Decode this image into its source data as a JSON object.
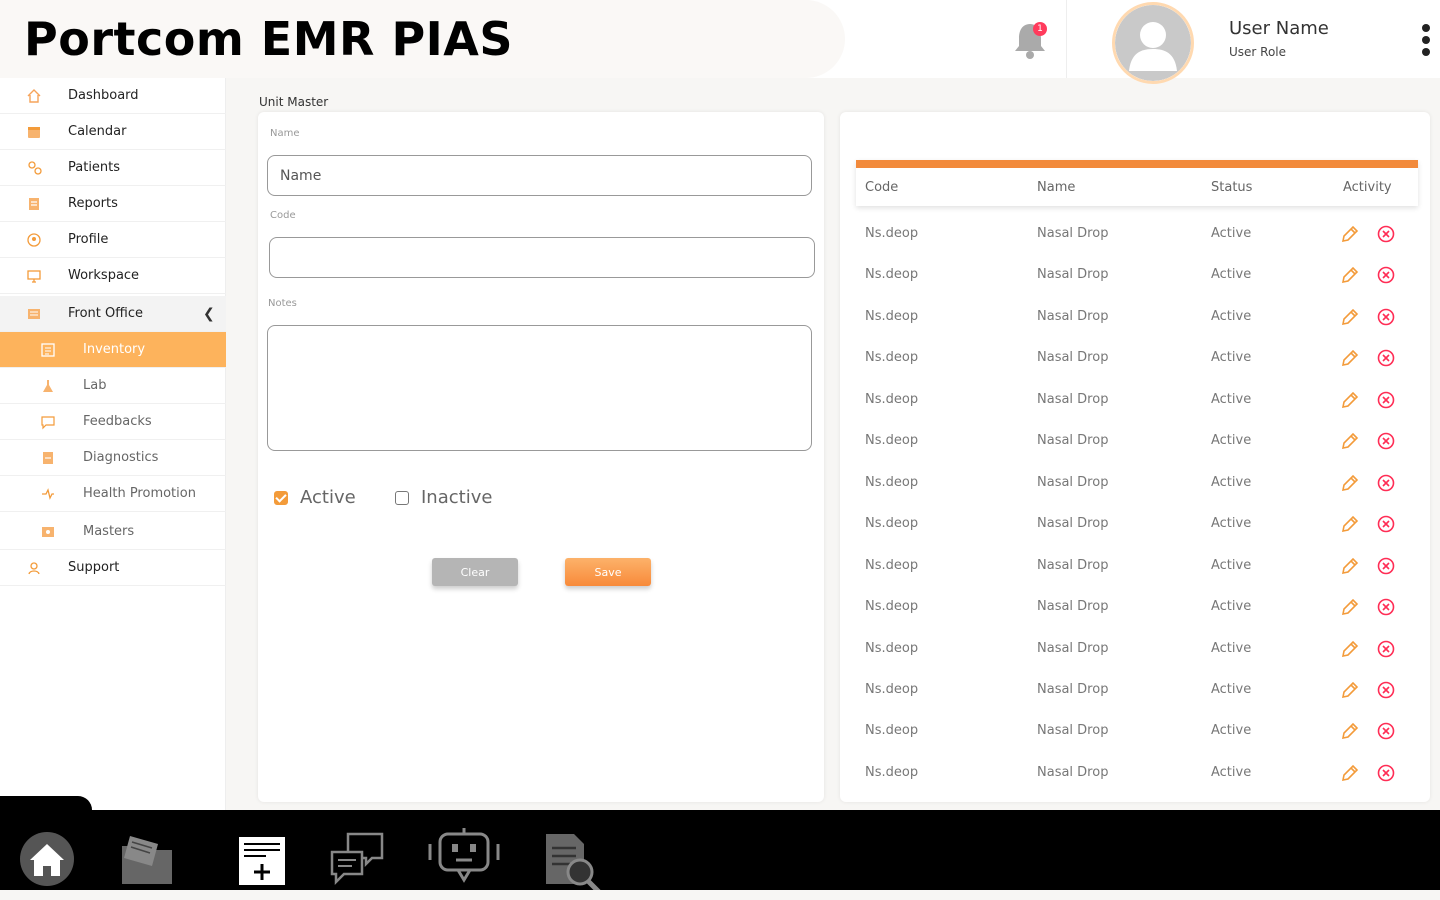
{
  "app": {
    "title": "Portcom EMR PIAS"
  },
  "header": {
    "notification_count": "1",
    "user_name": "User Name",
    "user_role": "User Role"
  },
  "sidebar": {
    "items": [
      {
        "label": "Dashboard",
        "icon": "home-icon"
      },
      {
        "label": "Calendar",
        "icon": "calendar-icon"
      },
      {
        "label": "Patients",
        "icon": "patients-icon"
      },
      {
        "label": "Reports",
        "icon": "reports-icon"
      },
      {
        "label": "Profile",
        "icon": "profile-icon"
      },
      {
        "label": "Workspace",
        "icon": "monitor-icon"
      },
      {
        "label": "Front Office",
        "icon": "front-office-icon",
        "expanded": true
      },
      {
        "label": "Inventory",
        "icon": "inventory-icon",
        "active": true
      },
      {
        "label": "Lab",
        "icon": "lab-icon"
      },
      {
        "label": "Feedbacks",
        "icon": "feedback-icon"
      },
      {
        "label": "Diagnostics",
        "icon": "diagnostics-icon"
      },
      {
        "label": "Health Promotion",
        "icon": "health-promotion-icon"
      },
      {
        "label": "Masters",
        "icon": "masters-icon"
      },
      {
        "label": "Support",
        "icon": "support-icon"
      }
    ]
  },
  "form": {
    "page_label": "Unit Master",
    "name_label": "Name",
    "name_placeholder": "Name",
    "name_value": "",
    "code_label": "Code",
    "code_value": "",
    "notes_label": "Notes",
    "notes_value": "",
    "active_label": "Active",
    "active_checked": true,
    "inactive_label": "Inactive",
    "inactive_checked": false,
    "clear_label": "Clear",
    "save_label": "Save"
  },
  "table": {
    "columns": [
      "Code",
      "Name",
      "Status",
      "Activity"
    ],
    "rows": [
      {
        "code": "Ns.deop",
        "name": "Nasal Drop",
        "status": "Active"
      },
      {
        "code": "Ns.deop",
        "name": "Nasal Drop",
        "status": "Active"
      },
      {
        "code": "Ns.deop",
        "name": "Nasal Drop",
        "status": "Active"
      },
      {
        "code": "Ns.deop",
        "name": "Nasal Drop",
        "status": "Active"
      },
      {
        "code": "Ns.deop",
        "name": "Nasal Drop",
        "status": "Active"
      },
      {
        "code": "Ns.deop",
        "name": "Nasal Drop",
        "status": "Active"
      },
      {
        "code": "Ns.deop",
        "name": "Nasal Drop",
        "status": "Active"
      },
      {
        "code": "Ns.deop",
        "name": "Nasal Drop",
        "status": "Active"
      },
      {
        "code": "Ns.deop",
        "name": "Nasal Drop",
        "status": "Active"
      },
      {
        "code": "Ns.deop",
        "name": "Nasal Drop",
        "status": "Active"
      },
      {
        "code": "Ns.deop",
        "name": "Nasal Drop",
        "status": "Active"
      },
      {
        "code": "Ns.deop",
        "name": "Nasal Drop",
        "status": "Active"
      },
      {
        "code": "Ns.deop",
        "name": "Nasal Drop",
        "status": "Active"
      },
      {
        "code": "Ns.deop",
        "name": "Nasal Drop",
        "status": "Active"
      }
    ]
  },
  "dock": {
    "icons": [
      "home-icon",
      "folder-icon",
      "medical-record-icon",
      "chat-icon",
      "bot-icon",
      "document-search-icon"
    ]
  },
  "colors": {
    "accent": "#f28a3b",
    "active_nav": "#fdb35c",
    "delete": "#ff2d55"
  }
}
